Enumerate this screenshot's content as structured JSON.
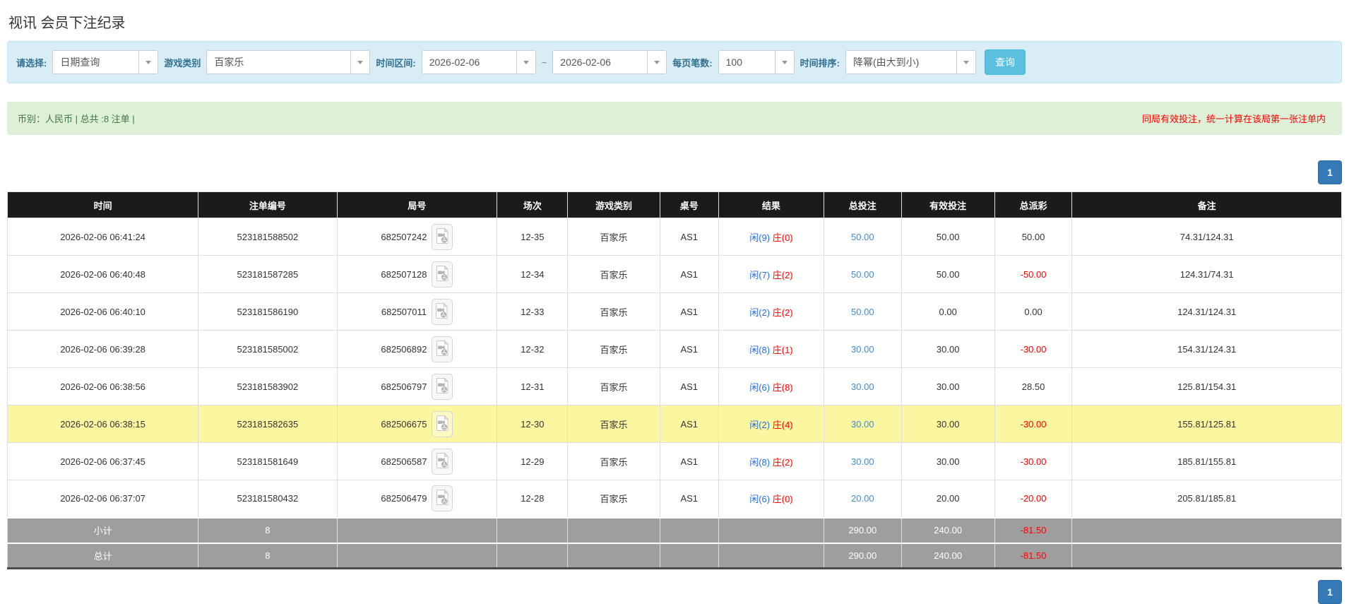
{
  "page": {
    "title": "视讯 会员下注纪录"
  },
  "filters": {
    "select_label": "请选择:",
    "select_value": "日期查询",
    "game_type_label": "游戏类别",
    "game_type_value": "百家乐",
    "time_range_label": "时间区间:",
    "date_from": "2026-02-06",
    "date_separator": "~",
    "date_to": "2026-02-06",
    "per_page_label": "每页笔数:",
    "per_page_value": "100",
    "sort_label": "时间排序:",
    "sort_value": "降幂(由大到小)",
    "search_button": "查询"
  },
  "info_bar": {
    "left_text": "币别：人民币 | 总共 :8 注单 |",
    "right_text": "同局有效投注，统一计算在该局第一张注单内"
  },
  "pagination": {
    "current_page": "1"
  },
  "icons": {
    "select_caret": "chevron-down-icon",
    "round_replay": "video-file-icon"
  },
  "colors": {
    "accent_blue": "#337ab7",
    "search_button": "#5bc0de",
    "filter_bar_bg": "#d9edf7",
    "info_bar_bg": "#dff0d8",
    "info_text_green": "#3c763d",
    "warning_red": "#ff0000",
    "header_bg": "#1b1b1b",
    "highlight_row": "#fbf7a1",
    "summary_row_bg": "#9e9e9e",
    "player_blue": "#2a6edb",
    "banker_red": "#ff0000",
    "link_blue": "#428bca"
  },
  "table": {
    "headers": [
      "时间",
      "注单编号",
      "局号",
      "场次",
      "游戏类别",
      "桌号",
      "结果",
      "总投注",
      "有效投注",
      "总派彩",
      "备注"
    ],
    "rows": [
      {
        "time": "2026-02-06 06:41:24",
        "bet_id": "523181588502",
        "round_id": "682507242",
        "session": "12-35",
        "game": "百家乐",
        "table_no": "AS1",
        "player": "闲(9)",
        "banker": "庄(0)",
        "total_bet": "50.00",
        "valid_bet": "50.00",
        "payout": "50.00",
        "remark": "74.31/124.31",
        "highlight": false
      },
      {
        "time": "2026-02-06 06:40:48",
        "bet_id": "523181587285",
        "round_id": "682507128",
        "session": "12-34",
        "game": "百家乐",
        "table_no": "AS1",
        "player": "闲(7)",
        "banker": "庄(2)",
        "total_bet": "50.00",
        "valid_bet": "50.00",
        "payout": "-50.00",
        "remark": "124.31/74.31",
        "highlight": false
      },
      {
        "time": "2026-02-06 06:40:10",
        "bet_id": "523181586190",
        "round_id": "682507011",
        "session": "12-33",
        "game": "百家乐",
        "table_no": "AS1",
        "player": "闲(2)",
        "banker": "庄(2)",
        "total_bet": "50.00",
        "valid_bet": "0.00",
        "payout": "0.00",
        "remark": "124.31/124.31",
        "highlight": false
      },
      {
        "time": "2026-02-06 06:39:28",
        "bet_id": "523181585002",
        "round_id": "682506892",
        "session": "12-32",
        "game": "百家乐",
        "table_no": "AS1",
        "player": "闲(8)",
        "banker": "庄(1)",
        "total_bet": "30.00",
        "valid_bet": "30.00",
        "payout": "-30.00",
        "remark": "154.31/124.31",
        "highlight": false
      },
      {
        "time": "2026-02-06 06:38:56",
        "bet_id": "523181583902",
        "round_id": "682506797",
        "session": "12-31",
        "game": "百家乐",
        "table_no": "AS1",
        "player": "闲(6)",
        "banker": "庄(8)",
        "total_bet": "30.00",
        "valid_bet": "30.00",
        "payout": "28.50",
        "remark": "125.81/154.31",
        "highlight": false
      },
      {
        "time": "2026-02-06 06:38:15",
        "bet_id": "523181582635",
        "round_id": "682506675",
        "session": "12-30",
        "game": "百家乐",
        "table_no": "AS1",
        "player": "闲(2)",
        "banker": "庄(4)",
        "total_bet": "30.00",
        "valid_bet": "30.00",
        "payout": "-30.00",
        "remark": "155.81/125.81",
        "highlight": true
      },
      {
        "time": "2026-02-06 06:37:45",
        "bet_id": "523181581649",
        "round_id": "682506587",
        "session": "12-29",
        "game": "百家乐",
        "table_no": "AS1",
        "player": "闲(8)",
        "banker": "庄(2)",
        "total_bet": "30.00",
        "valid_bet": "30.00",
        "payout": "-30.00",
        "remark": "185.81/155.81",
        "highlight": false
      },
      {
        "time": "2026-02-06 06:37:07",
        "bet_id": "523181580432",
        "round_id": "682506479",
        "session": "12-28",
        "game": "百家乐",
        "table_no": "AS1",
        "player": "闲(6)",
        "banker": "庄(0)",
        "total_bet": "20.00",
        "valid_bet": "20.00",
        "payout": "-20.00",
        "remark": "205.81/185.81",
        "highlight": false
      }
    ],
    "subtotal": {
      "label": "小计",
      "count": "8",
      "total_bet": "290.00",
      "valid_bet": "240.00",
      "payout": "-81.50"
    },
    "total": {
      "label": "总计",
      "count": "8",
      "total_bet": "290.00",
      "valid_bet": "240.00",
      "payout": "-81.50"
    }
  }
}
